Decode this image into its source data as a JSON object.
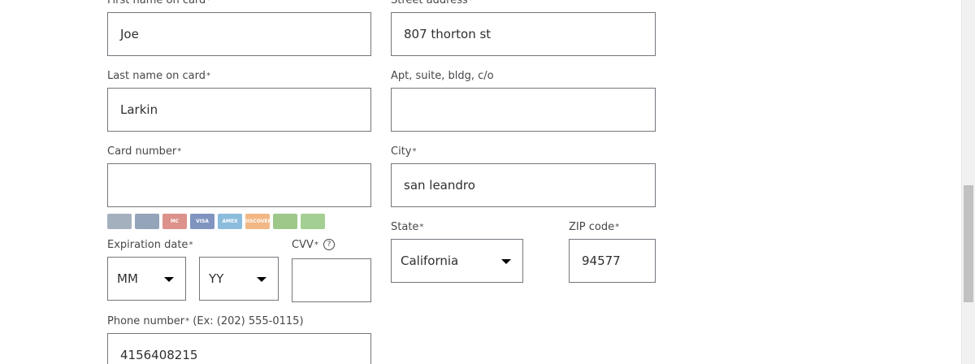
{
  "left_column": {
    "first_name": {
      "label": "First name on card",
      "required": "*",
      "value": "Joe"
    },
    "last_name": {
      "label": "Last name on card",
      "required": "*",
      "value": "Larkin"
    },
    "card_number": {
      "label": "Card number",
      "required": "*",
      "value": ""
    },
    "accepted_cards": [
      {
        "name": "walmart-card",
        "color": "#5b6f8a",
        "text": ""
      },
      {
        "name": "walmart-credit-card",
        "color": "#3d5a80",
        "text": ""
      },
      {
        "name": "mastercard",
        "color": "#c0392b",
        "text": "MC"
      },
      {
        "name": "visa",
        "color": "#1a3e8c",
        "text": "VISA"
      },
      {
        "name": "amex",
        "color": "#2e86c1",
        "text": "AMEX"
      },
      {
        "name": "discover",
        "color": "#e67e22",
        "text": "DISCOVER"
      },
      {
        "name": "gift-card-1",
        "color": "#4c9a2a",
        "text": ""
      },
      {
        "name": "gift-card-2",
        "color": "#5aa83a",
        "text": ""
      }
    ],
    "expiration": {
      "label": "Expiration date",
      "required": "*",
      "month": "MM",
      "year": "YY"
    },
    "cvv": {
      "label": "CVV",
      "required": "*",
      "help_icon": "?",
      "value": ""
    },
    "phone": {
      "label": "Phone number",
      "required": "*",
      "hint": "(Ex: (202) 555-0115)",
      "value": "4156408215"
    }
  },
  "right_column": {
    "street": {
      "label": "Street address",
      "required": "*",
      "value": "807 thorton st"
    },
    "apt": {
      "label": "Apt, suite, bldg, c/o",
      "value": ""
    },
    "city": {
      "label": "City",
      "required": "*",
      "value": "san leandro"
    },
    "state": {
      "label": "State",
      "required": "*",
      "value": "California"
    },
    "zip": {
      "label": "ZIP code",
      "required": "*",
      "value": "94577"
    }
  }
}
